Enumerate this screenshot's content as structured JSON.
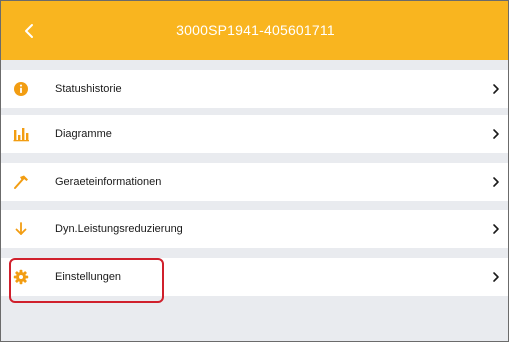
{
  "header": {
    "title": "3000SP1941-405601711",
    "back_icon": "chevron-left-icon",
    "background": "#f9b51f"
  },
  "menu": {
    "items": [
      {
        "label": "Statushistorie",
        "icon": "info-circle-icon"
      },
      {
        "label": "Diagramme",
        "icon": "bar-chart-icon"
      },
      {
        "label": "Geraeteinformationen",
        "icon": "hammer-icon"
      },
      {
        "label": "Dyn.Leistungsreduzierung",
        "icon": "arrow-down-icon"
      },
      {
        "label": "Einstellungen",
        "icon": "gear-icon"
      }
    ],
    "accent": "#f29d12",
    "highlight_color": "#d0202c"
  }
}
